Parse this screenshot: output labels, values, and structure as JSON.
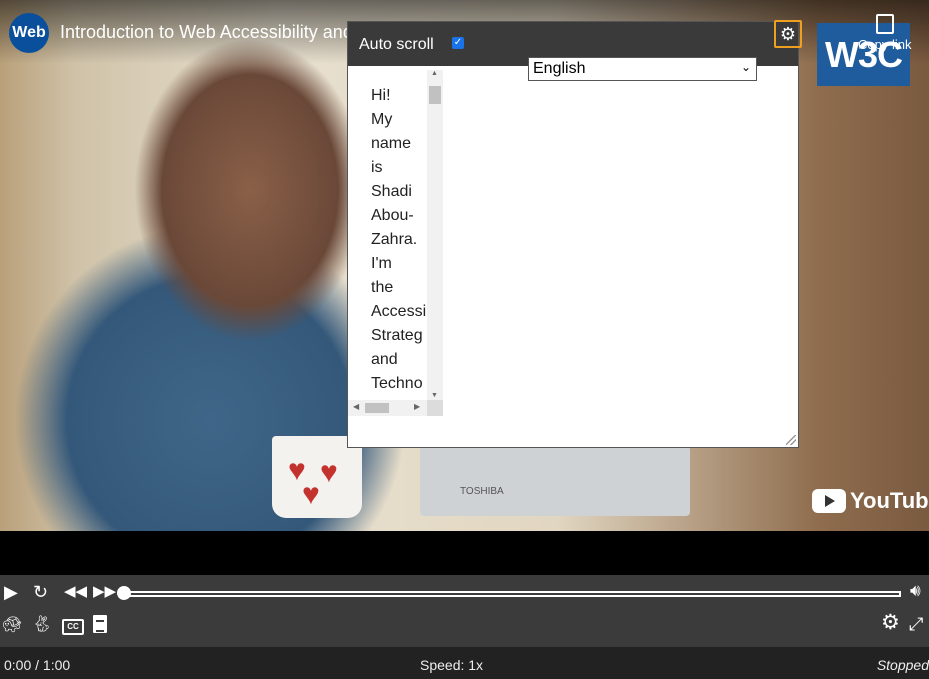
{
  "video": {
    "title": "Introduction to Web Accessibility and",
    "logo_text": "Web",
    "w3c_text": "W3C",
    "copy_link": "Copy link",
    "youtube": "YouTube",
    "laptop_brand": "TOSHIBA"
  },
  "transcript_panel": {
    "auto_scroll_label": "Auto scroll",
    "auto_scroll_checked": true,
    "language_selected": "English",
    "words": [
      "Hi!",
      "My",
      "name",
      "is",
      "Shadi",
      "Abou-",
      "Zahra.",
      "I'm",
      "the",
      "Accessi",
      "Strateg",
      "and",
      "Techno"
    ],
    "settings_icon": "gear-icon"
  },
  "player": {
    "time": "0:00 / 1:00",
    "speed": "Speed: 1x",
    "status": "Stopped",
    "progress_fraction": 0.0,
    "icons": [
      "play-icon",
      "restart-icon",
      "rewind-icon",
      "fast-forward-icon",
      "volume-icon",
      "slower-icon",
      "faster-icon",
      "captions-icon",
      "transcript-icon",
      "settings-icon",
      "fullscreen-icon"
    ]
  },
  "colors": {
    "focus_outline": "#f0a020",
    "control_bar": "#3b3b3b",
    "panel_header": "#3a3a3a"
  }
}
